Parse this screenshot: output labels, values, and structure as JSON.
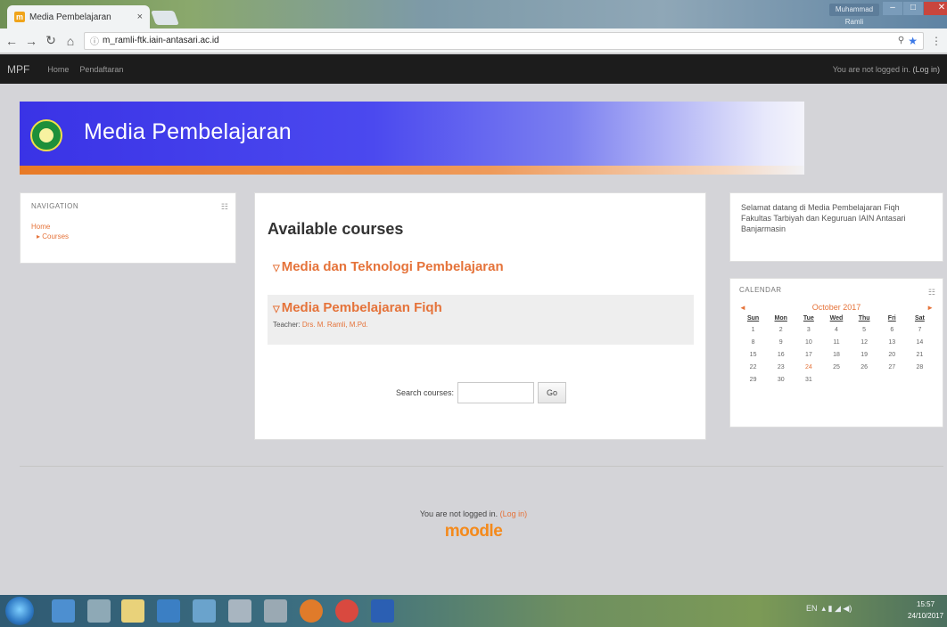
{
  "browser": {
    "tab_title": "Media Pembelajaran",
    "tab_close": "×",
    "url": "m_ramli-ftk.iain-antasari.ac.id",
    "win_user": "Muhammad Ramli",
    "win_min": "‒",
    "win_max": "□",
    "win_close": "✕"
  },
  "navbar": {
    "brand": "MPF",
    "links": [
      "Home",
      "Pendaftaran"
    ],
    "login_text": "You are not logged in.",
    "login_link": "(Log in)"
  },
  "header": {
    "site_title": "Media Pembelajaran",
    "banner_colors": [
      "#3a33e6",
      "#e87a26"
    ]
  },
  "navigation": {
    "title": "NAVIGATION",
    "home": "Home",
    "courses": "Courses"
  },
  "main": {
    "heading": "Available courses",
    "courses": [
      {
        "name": "Media dan Teknologi Pembelajaran"
      },
      {
        "name": "Media Pembelajaran Fiqh",
        "teacher_label": "Teacher:",
        "teacher": "Drs. M. Ramli, M.Pd."
      }
    ],
    "search_label": "Search courses:",
    "search_value": "",
    "go_label": "Go"
  },
  "welcome": {
    "text": "Selamat datang di Media Pembelajaran Fiqh Fakultas Tarbiyah dan Keguruan IAIN Antasari Banjarmasin"
  },
  "calendar": {
    "title": "CALENDAR",
    "month": "October 2017",
    "prev": "◄",
    "next": "►",
    "weekdays": [
      "Sun",
      "Mon",
      "Tue",
      "Wed",
      "Thu",
      "Fri",
      "Sat"
    ],
    "days": [
      "1",
      "2",
      "3",
      "4",
      "5",
      "6",
      "7",
      "8",
      "9",
      "10",
      "11",
      "12",
      "13",
      "14",
      "15",
      "16",
      "17",
      "18",
      "19",
      "20",
      "21",
      "22",
      "23",
      "24",
      "25",
      "26",
      "27",
      "28",
      "29",
      "30",
      "31"
    ],
    "today": "24"
  },
  "footer": {
    "login_text": "You are not logged in.",
    "login_link": "(Log in)",
    "logo": "moodle"
  },
  "taskbar": {
    "tray_lang": "EN",
    "time": "15:57",
    "date": "24/10/2017"
  },
  "colors": {
    "accent": "#e5733a",
    "navbar": "#1c1c1c"
  }
}
